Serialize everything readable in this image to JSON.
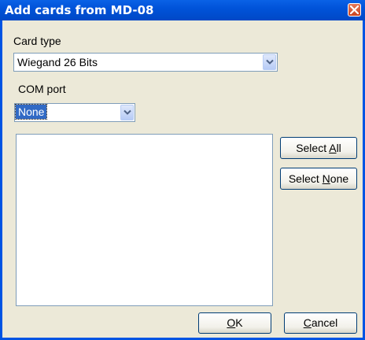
{
  "window": {
    "title": "Add cards from MD-08"
  },
  "card_type": {
    "label": "Card type",
    "selected": "Wiegand 26 Bits"
  },
  "com_port": {
    "label": "COM port",
    "selected": "None"
  },
  "buttons": {
    "select_all": {
      "prefix": "Select ",
      "mnemonic": "A",
      "suffix": "ll"
    },
    "select_none": {
      "prefix": "Select ",
      "mnemonic": "N",
      "suffix": "one"
    },
    "ok": {
      "prefix": "",
      "mnemonic": "O",
      "suffix": "K"
    },
    "cancel": {
      "prefix": "",
      "mnemonic": "C",
      "suffix": "ancel"
    }
  },
  "icons": {
    "close": "close-icon",
    "dropdown": "chevron-down-icon"
  },
  "colors": {
    "title_bar": "#0054e3",
    "dialog_bg": "#ece9d8",
    "selection": "#316ac5"
  }
}
